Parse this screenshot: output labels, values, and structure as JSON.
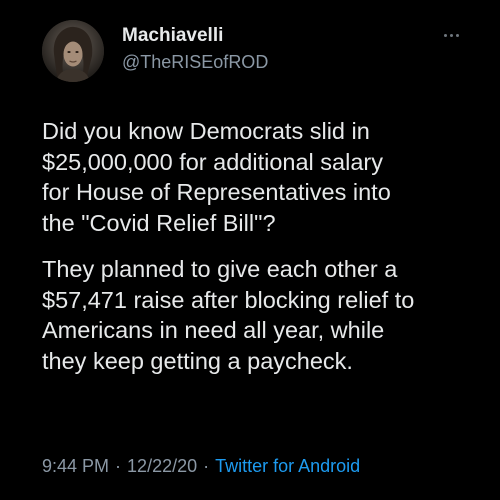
{
  "author": {
    "display_name": "Machiavelli",
    "handle": "@TheRISEofROD",
    "avatar_icon": "profile-photo-avatar"
  },
  "more_icon": "ellipsis-icon",
  "tweet": {
    "paragraph_1_lines": [
      "Did you know Democrats slid in",
      "$25,000,000 for additional salary",
      "for House of Representatives into",
      "the \"Covid Relief Bill\"?"
    ],
    "paragraph_2_lines": [
      "They planned to give each other a",
      "$57,471 raise after blocking relief to",
      "Americans in need all year, while",
      "they keep getting a paycheck."
    ]
  },
  "meta": {
    "time": "9:44 PM",
    "separator": "·",
    "date": "12/22/20",
    "client": "Twitter for Android"
  },
  "colors": {
    "background": "#000000",
    "text": "#e7e9ea",
    "secondary": "#8b98a5",
    "link": "#1d9bf0"
  }
}
